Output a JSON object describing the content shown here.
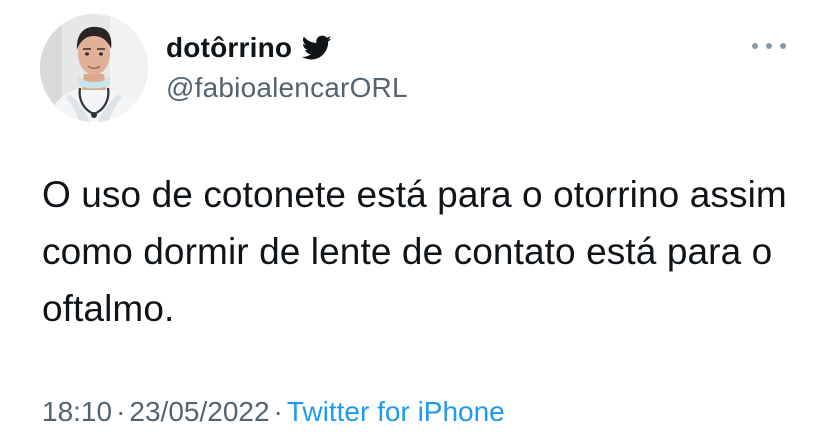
{
  "author": {
    "display_name": "dotôrrino",
    "handle": "@fabioalencarORL",
    "avatar_icon": "profile-photo",
    "badge_icon": "twitter-bird-icon"
  },
  "tweet": {
    "text": "O uso de cotonete está para o otorrino assim como dormir de lente de contato está para o oftalmo."
  },
  "meta": {
    "time": "18:10",
    "separator": "·",
    "date": "23/05/2022",
    "source": "Twitter for iPhone"
  },
  "menu": {
    "more_icon": "more-options-icon"
  },
  "colors": {
    "text": "#0f1419",
    "secondary": "#536471",
    "accent": "#1d9bf0",
    "background": "#ffffff"
  }
}
